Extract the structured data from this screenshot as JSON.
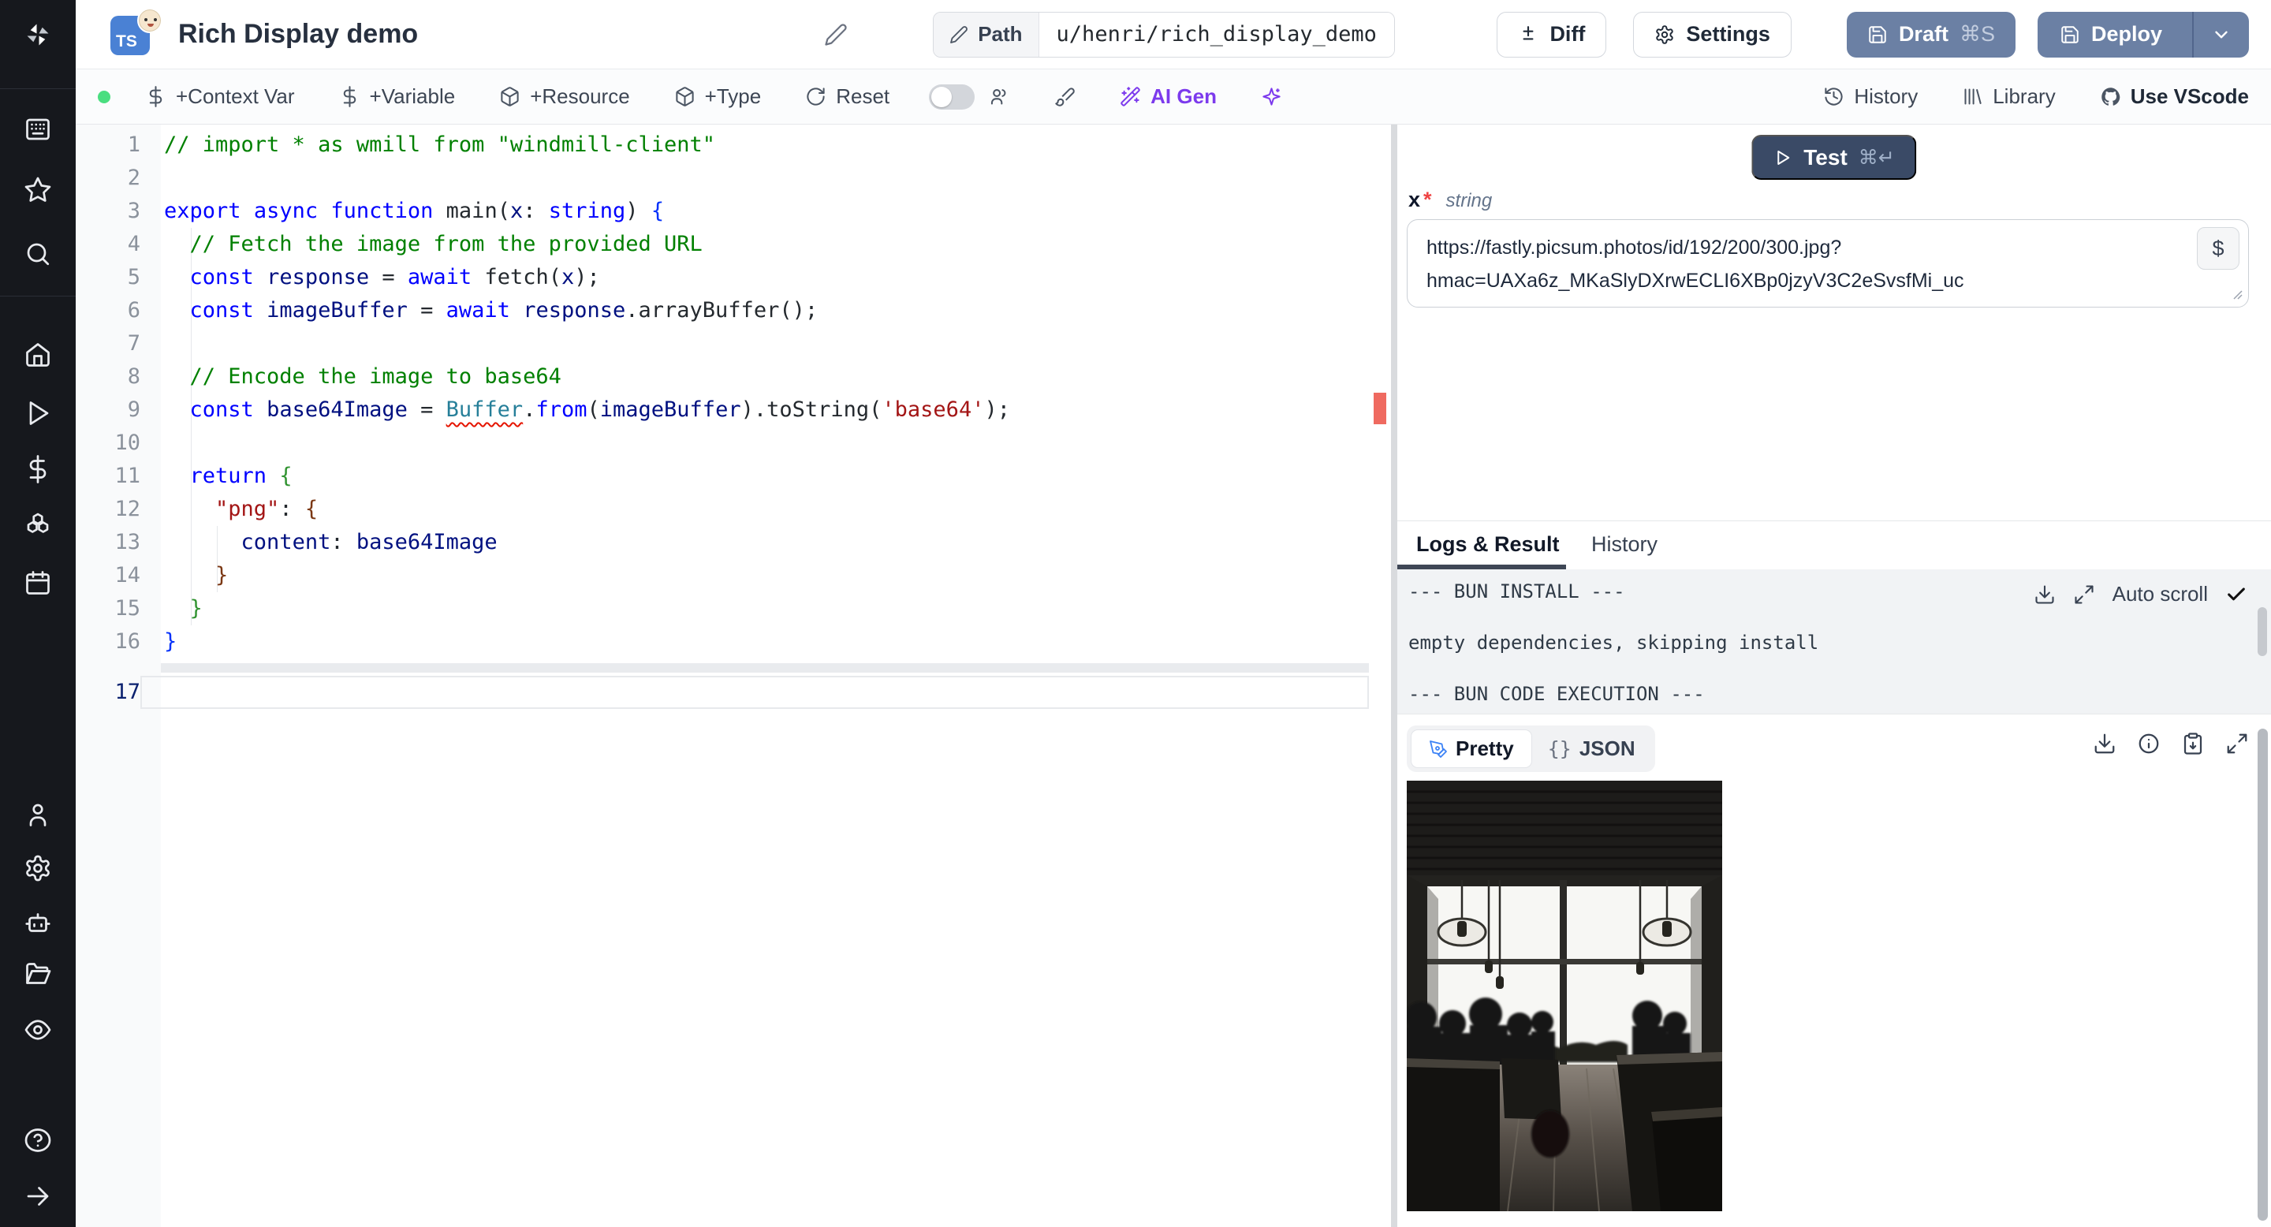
{
  "colors": {
    "accent_purple": "#7c3aed",
    "deploy_blue": "#6b80a4",
    "test_navy": "#3a4a66",
    "status_green": "#4ade80",
    "error_marker": "#ef6a60",
    "ts_badge_blue": "#4a81d4"
  },
  "sidebar": {
    "icons": [
      "windmill-logo",
      "app-window",
      "star",
      "search",
      "home",
      "play",
      "dollar",
      "boxes",
      "calendar",
      "user",
      "settings",
      "bot",
      "folder-open",
      "eye",
      "help-circle",
      "arrow-right"
    ]
  },
  "header": {
    "type_badge": "TS",
    "title": "Rich Display demo",
    "path_label": "Path",
    "path_value": "u/henri/rich_display_demo",
    "diff_label": "Diff",
    "settings_label": "Settings",
    "draft_label": "Draft",
    "draft_kbd": "⌘S",
    "deploy_label": "Deploy"
  },
  "toolbar": {
    "context_var": "+Context Var",
    "variable": "+Variable",
    "resource": "+Resource",
    "type": "+Type",
    "reset": "Reset",
    "ai_gen": "AI Gen",
    "history": "History",
    "library": "Library",
    "use_vscode": "Use VScode"
  },
  "editor": {
    "lines": [
      {
        "n": "1",
        "segs": [
          {
            "c": "cmt",
            "t": "// import * as wmill from \"windmill-client\""
          }
        ]
      },
      {
        "n": "2",
        "segs": []
      },
      {
        "n": "3",
        "segs": [
          {
            "c": "kw",
            "t": "export"
          },
          {
            "c": "pl",
            "t": " "
          },
          {
            "c": "kw",
            "t": "async"
          },
          {
            "c": "pl",
            "t": " "
          },
          {
            "c": "kw",
            "t": "function"
          },
          {
            "c": "pl",
            "t": " "
          },
          {
            "c": "fn",
            "t": "main"
          },
          {
            "c": "pl",
            "t": "("
          },
          {
            "c": "vr",
            "t": "x"
          },
          {
            "c": "pl",
            "t": ": "
          },
          {
            "c": "kw",
            "t": "string"
          },
          {
            "c": "pl",
            "t": ") "
          },
          {
            "c": "b1",
            "t": "{"
          }
        ]
      },
      {
        "n": "4",
        "segs": [
          {
            "c": "pl",
            "t": "  "
          },
          {
            "c": "cmt",
            "t": "// Fetch the image from the provided URL"
          }
        ]
      },
      {
        "n": "5",
        "segs": [
          {
            "c": "pl",
            "t": "  "
          },
          {
            "c": "kw",
            "t": "const"
          },
          {
            "c": "pl",
            "t": " "
          },
          {
            "c": "vr",
            "t": "response"
          },
          {
            "c": "pl",
            "t": " = "
          },
          {
            "c": "kw",
            "t": "await"
          },
          {
            "c": "pl",
            "t": " "
          },
          {
            "c": "fn",
            "t": "fetch"
          },
          {
            "c": "pl",
            "t": "("
          },
          {
            "c": "vr",
            "t": "x"
          },
          {
            "c": "pl",
            "t": ");"
          }
        ]
      },
      {
        "n": "6",
        "segs": [
          {
            "c": "pl",
            "t": "  "
          },
          {
            "c": "kw",
            "t": "const"
          },
          {
            "c": "pl",
            "t": " "
          },
          {
            "c": "vr",
            "t": "imageBuffer"
          },
          {
            "c": "pl",
            "t": " = "
          },
          {
            "c": "kw",
            "t": "await"
          },
          {
            "c": "pl",
            "t": " "
          },
          {
            "c": "vr",
            "t": "response"
          },
          {
            "c": "pl",
            "t": "."
          },
          {
            "c": "fn",
            "t": "arrayBuffer"
          },
          {
            "c": "pl",
            "t": "();"
          }
        ]
      },
      {
        "n": "7",
        "segs": []
      },
      {
        "n": "8",
        "segs": [
          {
            "c": "pl",
            "t": "  "
          },
          {
            "c": "cmt",
            "t": "// Encode the image to base64"
          }
        ]
      },
      {
        "n": "9",
        "segs": [
          {
            "c": "pl",
            "t": "  "
          },
          {
            "c": "kw",
            "t": "const"
          },
          {
            "c": "pl",
            "t": " "
          },
          {
            "c": "vr",
            "t": "base64Image"
          },
          {
            "c": "pl",
            "t": " = "
          },
          {
            "c": "type sq",
            "t": "Buffer"
          },
          {
            "c": "pl",
            "t": "."
          },
          {
            "c": "kw",
            "t": "from"
          },
          {
            "c": "pl",
            "t": "("
          },
          {
            "c": "vr",
            "t": "imageBuffer"
          },
          {
            "c": "pl",
            "t": ")."
          },
          {
            "c": "fn",
            "t": "toString"
          },
          {
            "c": "pl",
            "t": "("
          },
          {
            "c": "str",
            "t": "'base64'"
          },
          {
            "c": "pl",
            "t": ");"
          }
        ]
      },
      {
        "n": "10",
        "segs": []
      },
      {
        "n": "11",
        "segs": [
          {
            "c": "pl",
            "t": "  "
          },
          {
            "c": "kw",
            "t": "return"
          },
          {
            "c": "pl",
            "t": " "
          },
          {
            "c": "b2",
            "t": "{"
          }
        ]
      },
      {
        "n": "12",
        "segs": [
          {
            "c": "pl",
            "t": "    "
          },
          {
            "c": "str",
            "t": "\"png\""
          },
          {
            "c": "pl",
            "t": ": "
          },
          {
            "c": "b3",
            "t": "{"
          }
        ]
      },
      {
        "n": "13",
        "segs": [
          {
            "c": "pl",
            "t": "      "
          },
          {
            "c": "vr",
            "t": "content"
          },
          {
            "c": "pl",
            "t": ": "
          },
          {
            "c": "vr",
            "t": "base64Image"
          }
        ]
      },
      {
        "n": "14",
        "segs": [
          {
            "c": "pl",
            "t": "    "
          },
          {
            "c": "b3",
            "t": "}"
          }
        ]
      },
      {
        "n": "15",
        "segs": [
          {
            "c": "pl",
            "t": "  "
          },
          {
            "c": "b2",
            "t": "}"
          }
        ]
      },
      {
        "n": "16",
        "segs": [
          {
            "c": "b1",
            "t": "}"
          }
        ]
      },
      {
        "n": "17",
        "cur": true,
        "band": true,
        "segs": []
      }
    ]
  },
  "right_panel": {
    "test_label": "Test",
    "test_kbd": "⌘↵",
    "arg": {
      "name": "x",
      "required": "*",
      "type": "string",
      "value": "https://fastly.picsum.photos/id/192/200/300.jpg?\nhmac=UAXa6z_MKaSlyDXrwECLI6XBp0jzyV3C2eSvsfMi_uc",
      "var_button": "$"
    },
    "tabs": {
      "logs": "Logs & Result",
      "history": "History"
    },
    "logs": [
      "--- BUN INSTALL ---",
      "empty dependencies, skipping install",
      "--- BUN CODE EXECUTION ---"
    ],
    "auto_scroll": "Auto scroll",
    "result_tabs": {
      "pretty": "Pretty",
      "json": "JSON",
      "json_icon": "{}"
    }
  }
}
